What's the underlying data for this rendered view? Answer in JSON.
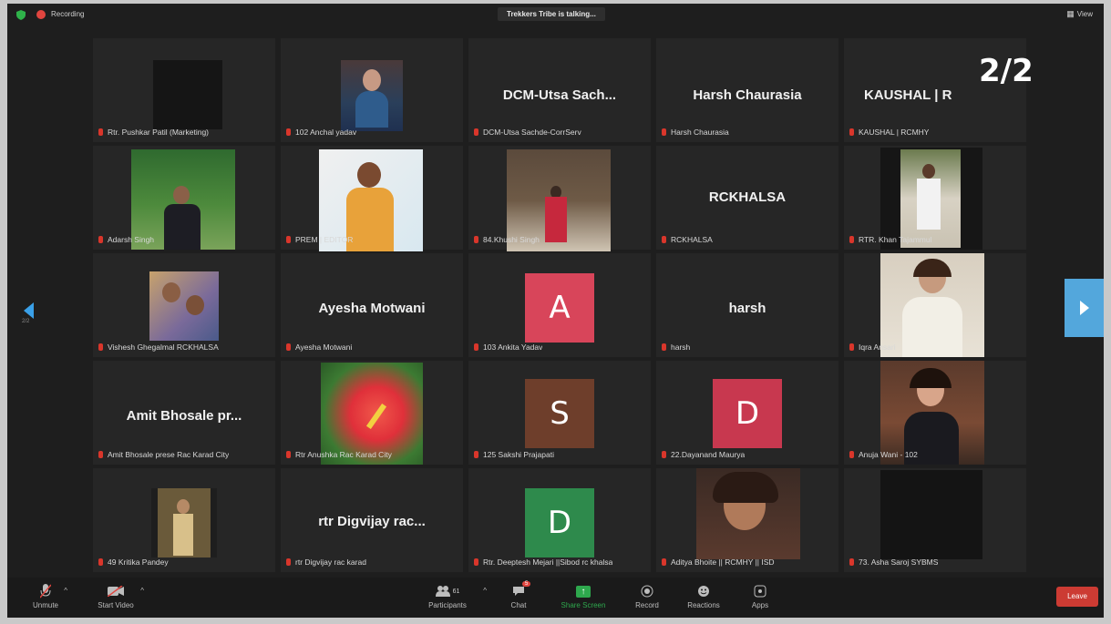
{
  "topbar": {
    "recording_label": "Recording",
    "talking_banner": "Trekkers Tribe is talking...",
    "view_label": "View",
    "view_icon": "▦",
    "shield_color": "#2fb24a",
    "rec_color": "#e0453f"
  },
  "page_indicator": "2/2",
  "nav": {
    "page_label": "2/2"
  },
  "participants": [
    {
      "name": "Rtr. Pushkar Patil (Marketing)"
    },
    {
      "name": "102 Anchal yadav"
    },
    {
      "name": "DCM-Utsa Sachde-CorrServ",
      "display": "DCM-Utsa Sach..."
    },
    {
      "name": "Harsh Chaurasia",
      "display": "Harsh Chaurasia"
    },
    {
      "name": "KAUSHAL | RCMHY",
      "display": "KAUSHAL | R"
    },
    {
      "name": "Adarsh Singh"
    },
    {
      "name": "PREM | EDITOR"
    },
    {
      "name": "84.Khushi Singh"
    },
    {
      "name": "RCKHALSA",
      "display": "RCKHALSA"
    },
    {
      "name": "RTR. Khan Tajammul"
    },
    {
      "name": "Vishesh Ghegalmal RCKHALSA"
    },
    {
      "name": "Ayesha Motwani",
      "display": "Ayesha Motwani"
    },
    {
      "name": "103 Ankita Yadav",
      "initial": "A"
    },
    {
      "name": "harsh",
      "display": "harsh"
    },
    {
      "name": "Iqra Ansari"
    },
    {
      "name": "Amit Bhosale prese Rac Karad City",
      "display": "Amit Bhosale pr..."
    },
    {
      "name": "Rtr Anushka Rac Karad City"
    },
    {
      "name": "125 Sakshi Prajapati",
      "initial": "S"
    },
    {
      "name": "22.Dayanand Maurya",
      "initial": "D"
    },
    {
      "name": "Anuja Wani - 102"
    },
    {
      "name": "49 Kritika Pandey"
    },
    {
      "name": "rtr Digvijay rac karad",
      "display": "rtr Digvijay rac..."
    },
    {
      "name": "Rtr. Deeptesh Mejari ||Sibod rc khalsa",
      "initial": "D"
    },
    {
      "name": "Aditya Bhoite || RCMHY || ISD"
    },
    {
      "name": "73. Asha Saroj SYBMS"
    }
  ],
  "colors": {
    "avatar_a": "#d8455a",
    "avatar_s": "#6e3e2b",
    "avatar_d1": "#c8384f",
    "avatar_d2": "#2e8a4c"
  },
  "toolbar": {
    "unmute_label": "Unmute",
    "video_label": "Start Video",
    "participants_label": "Participants",
    "participants_count": "61",
    "chat_label": "Chat",
    "chat_badge": "5",
    "share_label": "Share Screen",
    "record_label": "Record",
    "reactions_label": "Reactions",
    "apps_label": "Apps",
    "leave_label": "Leave"
  }
}
